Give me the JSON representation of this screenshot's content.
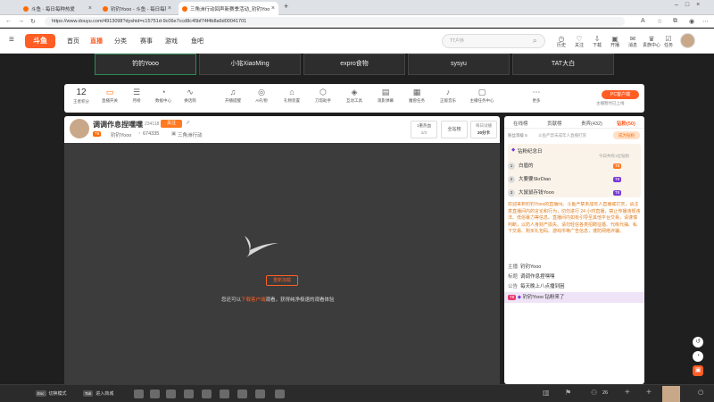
{
  "browser": {
    "tabs": [
      {
        "title": "斗鱼 - 每日每种热爱"
      },
      {
        "title": "钓钓Yooo - 斗鱼 - 每日每种热爱"
      },
      {
        "title": "三角洲行动回声新赛季活动_钓钓Yooo"
      }
    ],
    "new_tab": "+",
    "url": "https://www.douyu.com/4913098?dyshid=c15751d-9c06e7ccd8c45bf74f4b8a6d00041701"
  },
  "header": {
    "logo": "斗鱼",
    "menu": "≡",
    "nav": [
      "首页",
      "直播",
      "分类",
      "赛事",
      "游戏",
      "鱼吧"
    ],
    "nav_active": "直播",
    "search_placeholder": "TT户外",
    "right_icons": [
      {
        "icon": "history-icon",
        "label": "历史"
      },
      {
        "icon": "follow-icon",
        "label": "关注"
      },
      {
        "icon": "download-icon",
        "label": "下载"
      },
      {
        "icon": "live-icon",
        "label": "开播"
      },
      {
        "icon": "message-icon",
        "label": "消息"
      },
      {
        "icon": "vip-icon",
        "label": "贵族中心"
      },
      {
        "icon": "task-icon",
        "label": "任务"
      }
    ]
  },
  "streamers": [
    "钓钓Yooo",
    "小铭XiaoMing",
    "expro食物",
    "sysyu",
    "TAT大白"
  ],
  "tools": {
    "level_num": "12",
    "level_label": "王者积分",
    "items": [
      "直播开关",
      "月榜",
      "数据中心",
      "换话筒",
      "开播提醒",
      "AI礼物",
      "礼物装置",
      "刀塔助手",
      "互动工具",
      "观影弹幕",
      "魔兽任务",
      "正版音乐",
      "主播任务中心",
      "更多"
    ],
    "pc_btn": "PC客户端",
    "pc_sub": "主播暂时已上线"
  },
  "room": {
    "title": "调调作息捏嘿嘿",
    "fans": "234118",
    "follow": "关注",
    "level": "T8",
    "host": "钓钓Yooo",
    "hot": "674335",
    "category": "三角洲行动",
    "tag1": "1重热血",
    "tag1_sub": "2/3",
    "btn1": "全站榜",
    "btn2_top": "每日试播",
    "btn2_bot": "20分卡"
  },
  "video": {
    "retry": "重新加载",
    "tip_pre": "您还可以",
    "tip_link": "下载客户端",
    "tip_post": "观看，获得纯净极速的观看体验"
  },
  "chat": {
    "tabs": [
      "在线榜",
      "贡献榜",
      "贵宾(432)",
      "钻粉(50)"
    ],
    "tab_active": "钻粉(50)",
    "fan_label": "粉丝等级 5",
    "fan_desc": "斗鱼严禁未成年人直播打赏",
    "fan_btn": "成为钻粉",
    "diamond_title": "钻粉纪念日",
    "diamond_time": "今日共有1位钻粉",
    "ranks": [
      {
        "n": "1",
        "name": "白眉的"
      },
      {
        "n": "2",
        "name": "大要要SkrDiao"
      },
      {
        "n": "3",
        "name": "大鼠鼠存钱Yooo"
      }
    ],
    "notice": "欢迎来到钓钓Yooo的直播间。斗鱼严禁未成年人直播或打赏，请注意直播间内的言论和行为，切勿进行 24 小时直播，禁止传播违规违法、低俗暴力等信息。直播间内如有引导至其他平台交易，请谨慎判断，以防人身财产损失。请勿轻信各类招聘征婚、代练代抽、私下交易、购买礼包码、游戏币等广告信息，谨防网络诈骗。",
    "info": [
      {
        "k": "主播",
        "v": "钓钓Yooo"
      },
      {
        "k": "标题",
        "v": "调调作息捏嘿嘿"
      },
      {
        "k": "公告",
        "v": "每天晚上八点播到困"
      }
    ],
    "enter_msg": "钓钓Yooo 钻粉来了",
    "enter_lv": "T8"
  },
  "taskbar": {
    "items": [
      {
        "key": "Esc",
        "label": "切换模式"
      },
      {
        "key": "Tab",
        "label": "进入商城"
      }
    ],
    "count": "26"
  }
}
